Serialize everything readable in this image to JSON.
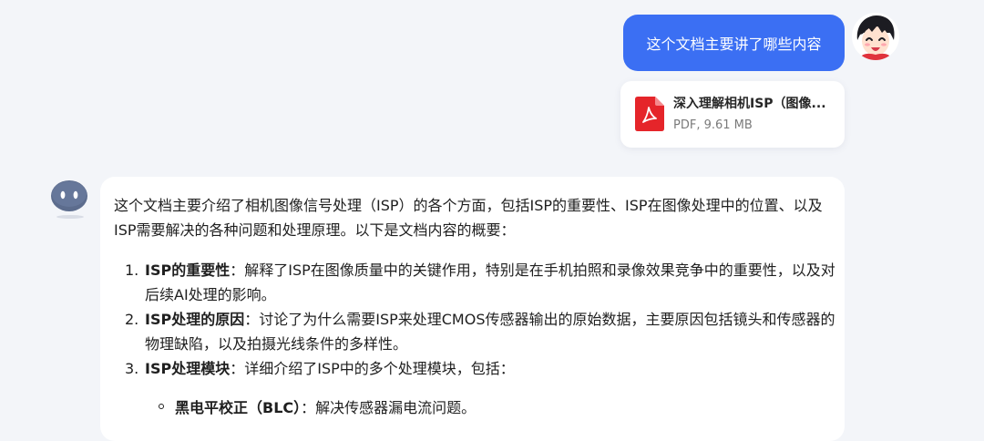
{
  "user_message": {
    "text": "这个文档主要讲了哪些内容",
    "bubble_color": "#3b6ff3"
  },
  "attachment": {
    "icon": "pdf-icon",
    "icon_color": "#e5252a",
    "name": "深入理解相机ISP（图像...",
    "meta": "PDF, 9.61 MB"
  },
  "assistant": {
    "avatar_icon": "robot-avatar-icon",
    "intro": "这个文档主要介绍了相机图像信号处理（ISP）的各个方面，包括ISP的重要性、ISP在图像处理中的位置、以及ISP需要解决的各种问题和处理原理。以下是文档内容的概要：",
    "items": [
      {
        "number": "1.",
        "title": "ISP的重要性",
        "text": "：解释了ISP在图像质量中的关键作用，特别是在手机拍照和录像效果竞争中的重要性，以及对后续AI处理的影响。"
      },
      {
        "number": "2.",
        "title": "ISP处理的原因",
        "text": "：讨论了为什么需要ISP来处理CMOS传感器输出的原始数据，主要原因包括镜头和传感器的物理缺陷，以及拍摄光线条件的多样性。"
      },
      {
        "number": "3.",
        "title": "ISP处理模块",
        "text": "：详细介绍了ISP中的多个处理模块，包括："
      }
    ],
    "sub_items": [
      {
        "title": "黑电平校正（BLC）",
        "text": "：解决传感器漏电流问题。"
      }
    ]
  }
}
